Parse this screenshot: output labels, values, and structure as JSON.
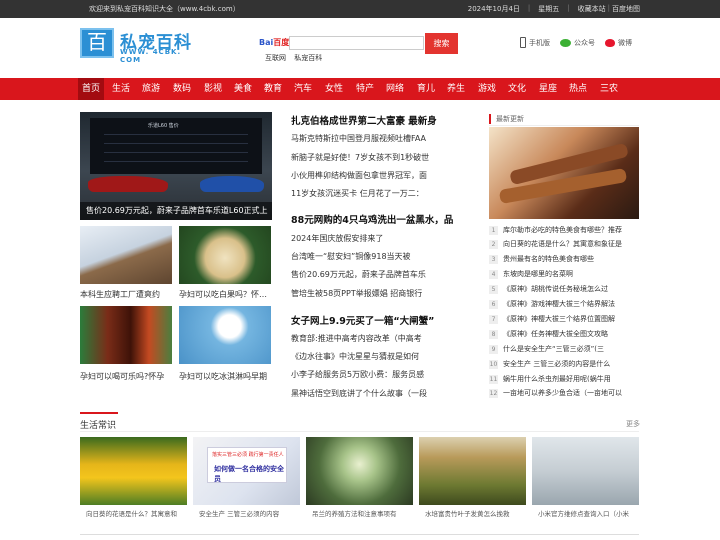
{
  "topbar": {
    "welcome": "欢迎来到私宠百科知识大全（www.4cbk.com）",
    "date": "2024年10月4日",
    "weekday": "星期五",
    "favorite": "收藏本站",
    "baidu_map": "百度地图"
  },
  "logo": {
    "glyph": "百",
    "title": "私宠百科",
    "url": "WWW. 4CBK. COM"
  },
  "search": {
    "engine_label": "Bai",
    "engine_label2": "百度",
    "placeholder": "",
    "button": "搜索",
    "radio_web": "互联网",
    "radio_site": "私宠百科"
  },
  "header_links": [
    {
      "label": "手机版",
      "icon": "phone-icon"
    },
    {
      "label": "公众号",
      "icon": "wechat-icon"
    },
    {
      "label": "微博",
      "icon": "weibo-icon"
    }
  ],
  "nav": [
    "首页",
    "生活",
    "旅游",
    "数码",
    "影视",
    "美食",
    "教育",
    "汽车",
    "女性",
    "特产",
    "网络",
    "育儿",
    "养生",
    "游戏",
    "文化",
    "星座",
    "热点",
    "三农"
  ],
  "nav_active": 0,
  "featured": {
    "caption": "售价20.69万元起，蔚来子品牌首车乐道L60正式上",
    "screen_title": "乐道L60 售价"
  },
  "small_items": [
    {
      "caption": "本科生应聘工厂遭爽约"
    },
    {
      "caption": "孕妇可以吃白果吗？怀孕能"
    },
    {
      "caption": "孕妇可以喝可乐吗?怀孕"
    },
    {
      "caption": "孕妇可以吃冰淇淋吗早期"
    }
  ],
  "center_groups": [
    {
      "headline": "扎克伯格成世界第二大富豪 最新身",
      "items": [
        "马斯克特斯拉中国登月服视频吐槽FAA",
        "新脑子就是好使！7岁女孩不到1秒破世",
        "小伙用榫卯结构做面包拿世界冠军，面",
        "11岁女孩沉迷买卡 仨月花了一万二："
      ]
    },
    {
      "headline": "88元网购的4只乌鸡洗出一盆黑水，品",
      "items": [
        "2024年国庆放假安排来了",
        "台湾唯一“慰安妇”铜像918当天被",
        "售价20.69万元起，蔚来子品牌首车乐",
        "管培生被58页PPT举报嫖娼 招商银行"
      ]
    },
    {
      "headline": "女子网上9.9元买了一箱“大闸蟹”",
      "items": [
        "教育部:推进中高考内容改革（中高考",
        "《边水往事》中沈星星与猜叔是如何",
        "小李子给服务员5万欧小费：服务员感",
        "黑神话悟空到底讲了个什么故事（一段"
      ]
    }
  ],
  "latest": {
    "title": "最新更新",
    "items": [
      "库尔勒市必吃的特色美食有哪些？推荐",
      "向日葵的花语是什么？其寓意和象征是",
      "贵州最有名的特色美食有哪些",
      "东坡肉是哪里的名菜啊",
      "《原神》胡桃传说任务秘境怎么过",
      "《原神》游戏神樱大祓三个结界解法",
      "《原神》神樱大祓三个结界位置图解",
      "《原神》任务神樱大祓全图文攻略",
      "什么是安全生产“三管三必须”(三",
      "安全生产 三管三必须的内容是什么",
      "蜗牛用什么杀虫剂最好用呢(蜗牛用",
      "一亩地可以养多少鱼合适（一亩地可以"
    ]
  },
  "section": {
    "title": "生活常识",
    "more": "更多",
    "banner_small": "落实三管三必须 践行第一责任人",
    "banner_big": "如何做一名合格的安全员",
    "cards": [
      {
        "caption": "向日葵的花语是什么？其寓意和"
      },
      {
        "caption": "安全生产 三管三必须的内容"
      },
      {
        "caption": "吊兰的养殖方法和注意事项有"
      },
      {
        "caption": "水培富贵竹叶子发黄怎么挽救"
      },
      {
        "caption": "小米官方维修点查询入口（小米"
      }
    ]
  },
  "colors": {
    "brand_red": "#d9161c",
    "brand_blue": "#2b8fd4",
    "topbar": "#333333"
  }
}
